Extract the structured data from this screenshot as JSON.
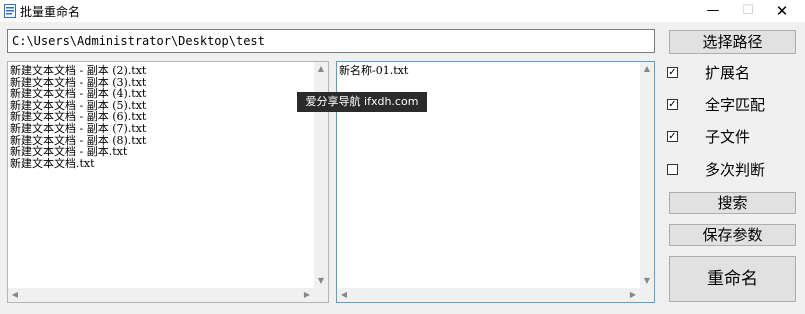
{
  "window": {
    "title": "批量重命名",
    "controls": {
      "minimize": "—",
      "maximize": "☐",
      "close": "✕"
    }
  },
  "path": {
    "value": "C:\\Users\\Administrator\\Desktop\\test"
  },
  "source_files": [
    "新建文本文档 - 副本 (2).txt",
    "新建文本文档 - 副本 (3).txt",
    "新建文本文档 - 副本 (4).txt",
    "新建文本文档 - 副本 (5).txt",
    "新建文本文档 - 副本 (6).txt",
    "新建文本文档 - 副本 (7).txt",
    "新建文本文档 - 副本 (8).txt",
    "新建文本文档 - 副本.txt",
    "新建文本文档.txt"
  ],
  "target_files": [
    "新名称-01.txt"
  ],
  "watermark": "爱分享导航 ifxdh.com",
  "buttons": {
    "select_path": "选择路径",
    "search": "搜索",
    "save_params": "保存参数",
    "rename": "重命名"
  },
  "options": [
    {
      "label": "扩展名",
      "checked": true
    },
    {
      "label": "全字匹配",
      "checked": true
    },
    {
      "label": "子文件",
      "checked": true
    },
    {
      "label": "多次判断",
      "checked": false
    }
  ],
  "icons": {
    "app": "app-document-icon"
  },
  "colors": {
    "focus_border": "#5aa0c8",
    "window_bg": "#f0f0f0"
  }
}
